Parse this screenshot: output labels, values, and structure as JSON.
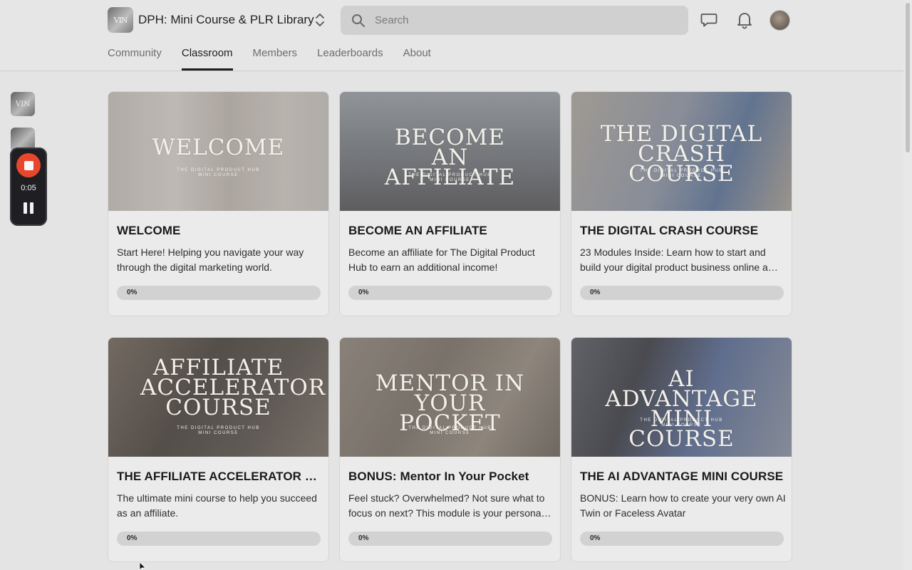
{
  "header": {
    "group_logo_text": "VIN",
    "group_name": "DPH: Mini Course & PLR Library",
    "search_placeholder": "Search"
  },
  "tabs": [
    {
      "label": "Community",
      "active": false
    },
    {
      "label": "Classroom",
      "active": true
    },
    {
      "label": "Members",
      "active": false
    },
    {
      "label": "Leaderboards",
      "active": false
    },
    {
      "label": "About",
      "active": false
    }
  ],
  "recorder": {
    "time": "0:05",
    "record_color": "#e8472d"
  },
  "courses": [
    {
      "image_title": "WELCOME",
      "image_subtitle": "THE DIGITAL PRODUCT HUB",
      "image_subtitle2": "MINI COURSE",
      "title": "WELCOME",
      "description": "Start Here! Helping you navigate your way through the digital marketing world.",
      "progress_label": "0%",
      "progress": 0
    },
    {
      "image_title": "BECOME AN AFFILIATE",
      "image_subtitle": "THE DIGITAL PRODUCT HUB",
      "image_subtitle2": "MINI COURSE",
      "title": "BECOME AN AFFILIATE",
      "description": "Become an affiliate for The Digital Product Hub to earn an additional income!",
      "progress_label": "0%",
      "progress": 0
    },
    {
      "image_title": "THE DIGITAL CRASH COURSE",
      "image_subtitle": "THE DIGITAL PRODUCT HUB",
      "image_subtitle2": "MINI COURSE",
      "title": "THE DIGITAL CRASH COURSE",
      "description": "23 Modules Inside: Learn how to start and build your digital product business online a…",
      "progress_label": "0%",
      "progress": 0
    },
    {
      "image_title": "AFFILIATE ACCELERATOR COURSE",
      "image_subtitle": "THE DIGITAL PRODUCT HUB",
      "image_subtitle2": "MINI COURSE",
      "title": "THE AFFILIATE ACCELERATOR C…",
      "description": "The ultimate mini course to help you succeed as an affiliate.",
      "progress_label": "0%",
      "progress": 0
    },
    {
      "image_title": "MENTOR IN YOUR POCKET",
      "image_subtitle": "THE DIGITAL PRODUCT HUB",
      "image_subtitle2": "MINI COURSE",
      "title": "BONUS: Mentor In Your Pocket",
      "description": "Feel stuck? Overwhelmed? Not sure what to focus on next? This module is your persona…",
      "progress_label": "0%",
      "progress": 0
    },
    {
      "image_title": "AI ADVANTAGE MINI COURSE",
      "image_subtitle": "THE DIGITAL PRODUCT HUB",
      "image_subtitle2": "MINI COURSE",
      "title": "THE AI ADVANTAGE MINI COURSE",
      "description": "BONUS: Learn how to create your very own AI Twin or Faceless Avatar",
      "progress_label": "0%",
      "progress": 0
    }
  ]
}
